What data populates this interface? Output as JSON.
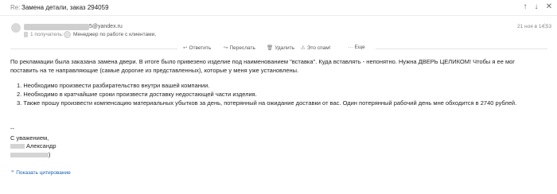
{
  "header": {
    "re_prefix": "Re:",
    "subject": "Замена детали, заказ 294059",
    "prev_icon": "arrow-up-icon",
    "next_icon": "arrow-down-icon",
    "close_icon": "close-icon"
  },
  "sender": {
    "email_domain": "5@yandex.ru",
    "recipients_label": "1 получатель:",
    "recipient_name": "Менеджер по работе с клиентами,",
    "date": "21 ноя в 14:53"
  },
  "actions": {
    "reply": "Ответить",
    "forward": "Переслать",
    "delete": "Удалить",
    "spam": "Это спам!",
    "more": "Еще"
  },
  "body": {
    "para1_line1": "По рекламации была заказана замена двери. В итоге было привезено изделие под наименованием  \"вставка\". Куда вставлять - непонятно. Нужна ДВЕРЬ ЦЕЛИКОМ! Чтобы я ее мог",
    "para1_line2": "поставить на те направляющие (самые дорогие из представленных), которые у меня уже установлены.",
    "items": [
      "1. Необходимо произвести разбирательство внутри вашей компании.",
      "2. Необходимо в кратчайшие сроки произвести доставку недостающей части изделия.",
      "3. Также прошу произвести компенсацию материальных убытков за день, потерянный на ожидание доставки от вас. Один потерянный рабочий день мне обходится в 2740 рублей."
    ],
    "sig_dashes": "--",
    "sig_regards": "С уважением,",
    "sig_name": "Александр",
    "sig_tail": ")"
  },
  "footer": {
    "show_quote": "Показать цитирование"
  }
}
